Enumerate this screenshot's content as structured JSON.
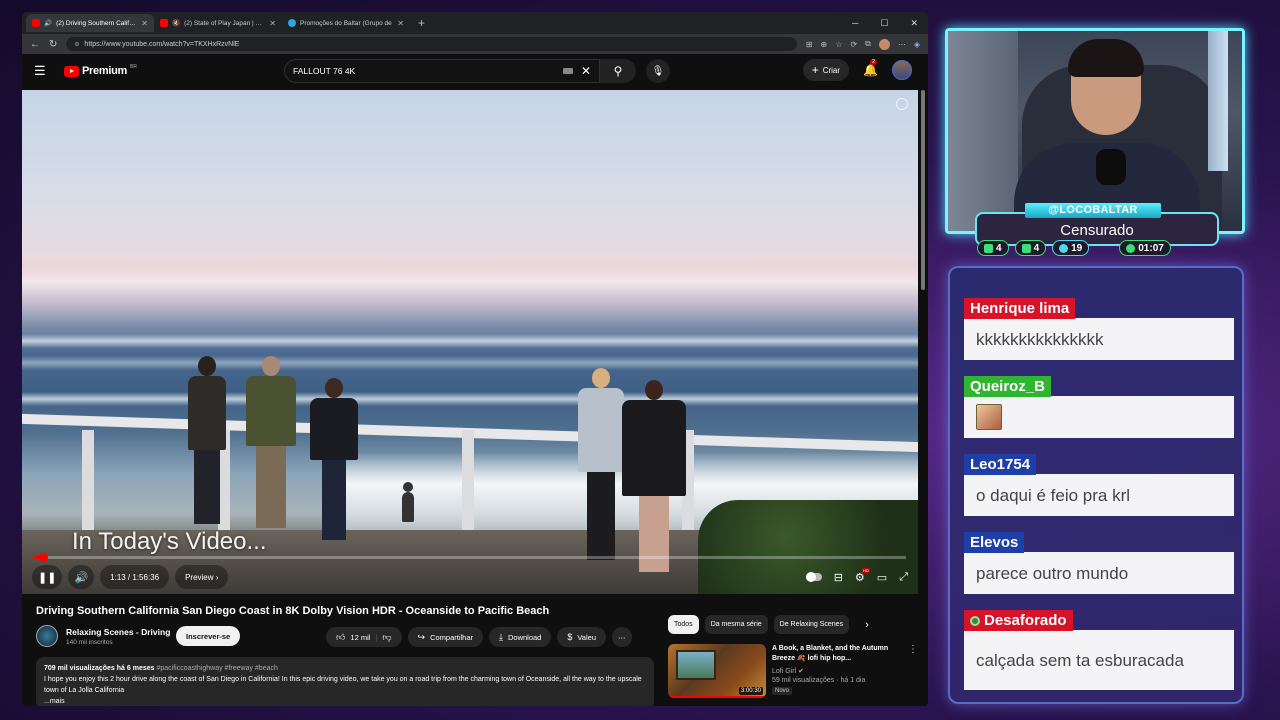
{
  "browser": {
    "tabs": [
      {
        "title": "(2) Driving Southern Californ",
        "fav_color": "#ff0000",
        "active": true
      },
      {
        "title": "(2) State of Play Japan | Nov",
        "fav_color": "#ff0000",
        "active": false
      },
      {
        "title": "Promoções do Baltar (Grupo de ",
        "fav_color": "#2ca5e0",
        "active": false
      }
    ],
    "url": "https://www.youtube.com/watch?v=TKXHxRzvNlE"
  },
  "youtube": {
    "logo_text": "Premium",
    "country_code": "BR",
    "search_value": "FALLOUT 76 4K",
    "create_label": "Criar",
    "notification_count": "2"
  },
  "video": {
    "caption": "In Today's Video...",
    "time": "1:13 / 1:56:36",
    "chapter": "Preview",
    "progress": 0.0104
  },
  "watch": {
    "title": "Driving Southern California San Diego Coast in 8K Dolby Vision HDR - Oceanside to Pacific Beach",
    "channel_name": "Relaxing Scenes - Driving",
    "subscribers": "140 mil inscritos",
    "subscribe_label": "Inscrever-se",
    "likes": "12 mil",
    "share_label": "Compartilhar",
    "download_label": "Download",
    "thanks_label": "Valeu",
    "desc_meta": "709 mil visualizações  há 6 meses",
    "desc_tags": "#pacificcoasthighway #freeway #beach",
    "desc_text": "I hope you enjoy this 2 hour drive along the coast of San Diego in California! In this epic driving video, we take you on a road trip from the charming town of Oceanside, all the way to the upscale town of La Jolla California",
    "desc_more": "...mais"
  },
  "chips": [
    "Todos",
    "Da mesma série",
    "De Relaxing Scenes"
  ],
  "recommendation": {
    "title": "A Book, a Blanket, and the Autumn Breeze 🍂 lofi hip hop...",
    "channel": "Lofi Girl",
    "meta": "59 mil visualizações · há 1 dia",
    "badge": "Novo",
    "duration": "3:00:30"
  },
  "overlay": {
    "streamer_name": "@LOCOBALTAR",
    "status": "Censurado",
    "stats": [
      {
        "icon": "chat-icon",
        "value": "4"
      },
      {
        "icon": "youtube-icon",
        "value": "4"
      },
      {
        "icon": "link-icon",
        "value": "19"
      },
      {
        "icon": "clock-icon",
        "value": "01:07"
      }
    ]
  },
  "chat": [
    {
      "user": "Henrique lima",
      "color": "#d7132a",
      "text": "kkkkkkkkkkkkkkk"
    },
    {
      "user": "Queiroz_B",
      "color": "#2fb530",
      "text": "",
      "emote": true
    },
    {
      "user": "Leo1754",
      "color": "#1e3fa8",
      "text": "o daqui é feio pra krl"
    },
    {
      "user": "Elevos",
      "color": "#1e3fa8",
      "text": "parece outro mundo"
    },
    {
      "user": "Desaforado",
      "color": "#d7132a",
      "text": "calçada sem ta esburacada",
      "badge": true
    }
  ]
}
